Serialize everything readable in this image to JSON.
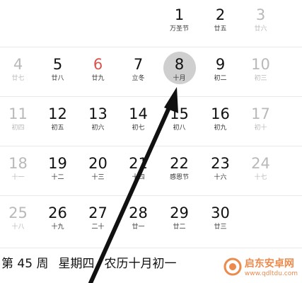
{
  "calendar": {
    "rows": [
      [
        {
          "day": "",
          "sub": "",
          "state": "empty"
        },
        {
          "day": "",
          "sub": "",
          "state": "empty"
        },
        {
          "day": "",
          "sub": "",
          "state": "empty"
        },
        {
          "day": "",
          "sub": "",
          "state": "empty"
        },
        {
          "day": "1",
          "sub": "万圣节",
          "state": "normal"
        },
        {
          "day": "2",
          "sub": "廿五",
          "state": "normal"
        },
        {
          "day": "3",
          "sub": "廿六",
          "state": "muted"
        }
      ],
      [
        {
          "day": "4",
          "sub": "廿七",
          "state": "muted"
        },
        {
          "day": "5",
          "sub": "廿八",
          "state": "normal"
        },
        {
          "day": "6",
          "sub": "廿九",
          "state": "red"
        },
        {
          "day": "7",
          "sub": "立冬",
          "state": "normal"
        },
        {
          "day": "8",
          "sub": "十月",
          "state": "selected"
        },
        {
          "day": "9",
          "sub": "初二",
          "state": "normal"
        },
        {
          "day": "10",
          "sub": "初三",
          "state": "muted"
        }
      ],
      [
        {
          "day": "11",
          "sub": "初四",
          "state": "muted"
        },
        {
          "day": "12",
          "sub": "初五",
          "state": "normal"
        },
        {
          "day": "13",
          "sub": "初六",
          "state": "normal"
        },
        {
          "day": "14",
          "sub": "初七",
          "state": "normal"
        },
        {
          "day": "15",
          "sub": "初八",
          "state": "normal"
        },
        {
          "day": "16",
          "sub": "初九",
          "state": "normal"
        },
        {
          "day": "17",
          "sub": "初十",
          "state": "muted"
        }
      ],
      [
        {
          "day": "18",
          "sub": "十一",
          "state": "muted"
        },
        {
          "day": "19",
          "sub": "十二",
          "state": "normal"
        },
        {
          "day": "20",
          "sub": "十三",
          "state": "normal"
        },
        {
          "day": "21",
          "sub": "十四",
          "state": "normal"
        },
        {
          "day": "22",
          "sub": "感恩节",
          "state": "normal"
        },
        {
          "day": "23",
          "sub": "十六",
          "state": "normal"
        },
        {
          "day": "24",
          "sub": "十七",
          "state": "muted"
        }
      ],
      [
        {
          "day": "25",
          "sub": "十八",
          "state": "muted"
        },
        {
          "day": "26",
          "sub": "十九",
          "state": "normal"
        },
        {
          "day": "27",
          "sub": "二十",
          "state": "normal"
        },
        {
          "day": "28",
          "sub": "廿一",
          "state": "normal"
        },
        {
          "day": "29",
          "sub": "廿二",
          "state": "normal"
        },
        {
          "day": "30",
          "sub": "廿三",
          "state": "normal"
        },
        {
          "day": "",
          "sub": "",
          "state": "empty"
        }
      ]
    ]
  },
  "footer": {
    "week": "第 45 周",
    "weekday": "星期四",
    "lunar": "农历十月初一"
  },
  "watermark": {
    "name": "启东安卓网",
    "url": "www.qdltdu.com"
  },
  "colors": {
    "accent_red": "#d9534f",
    "selected_circle": "#cfcfcf",
    "watermark": "#e8762d"
  }
}
